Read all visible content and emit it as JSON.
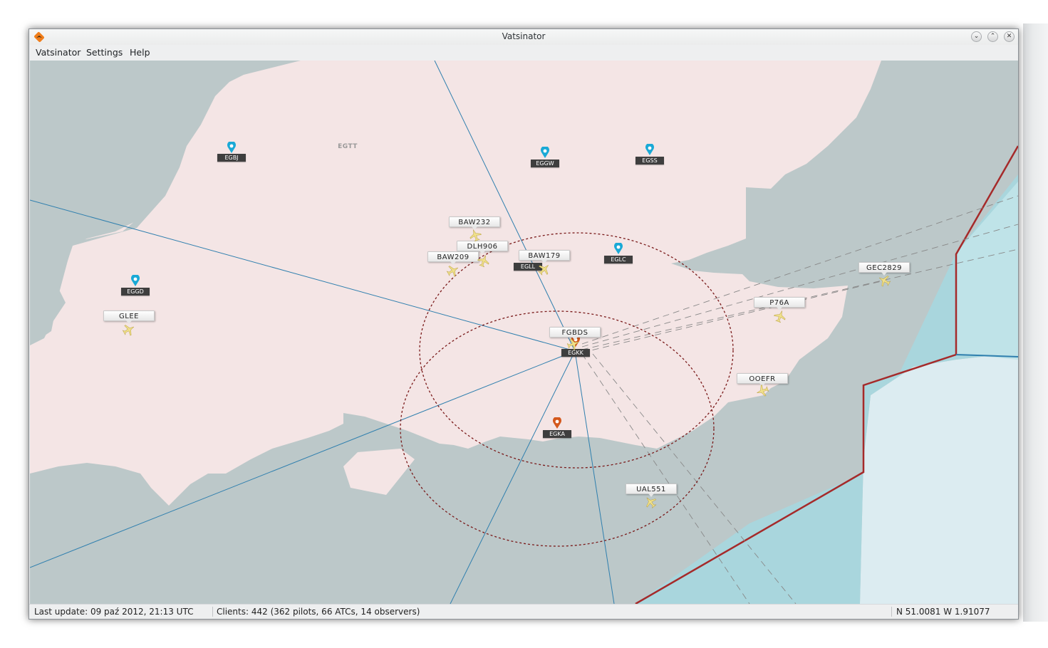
{
  "window": {
    "title": "Vatsinator",
    "buttons": [
      "minimize",
      "maximize",
      "close"
    ]
  },
  "menu": {
    "items": [
      "Vatsinator",
      "Settings",
      "Help"
    ]
  },
  "map": {
    "fir": "EGTT",
    "airports": [
      {
        "code": "EGBJ",
        "icon": "airport-marker-blue"
      },
      {
        "code": "EGGW",
        "icon": "airport-marker-blue"
      },
      {
        "code": "EGSS",
        "icon": "airport-marker-blue"
      },
      {
        "code": "EGLC",
        "icon": "airport-marker-blue"
      },
      {
        "code": "EGGD",
        "icon": "airport-marker-blue"
      },
      {
        "code": "EGLL",
        "icon": "airport-marker-none"
      },
      {
        "code": "EGKK",
        "icon": "airport-marker-orange"
      },
      {
        "code": "EGKA",
        "icon": "airport-marker-orange"
      }
    ],
    "flights": [
      "BAW232",
      "DLH906",
      "BAW209",
      "BAW179",
      "GLEE",
      "FGBDS",
      "P76A",
      "GEC2829",
      "OOEFR",
      "UAL551"
    ]
  },
  "status": {
    "last_update": "Last update: 09 paź 2012, 21:13 UTC",
    "clients": "Clients: 442 (362 pilots, 66 ATCs, 14 observers)",
    "coords": "N 51.0081 W 1.91077"
  },
  "colors": {
    "land_fir": "#f4e5e5",
    "land_outside": "#bcc8c9",
    "sea": "#a9d6dd",
    "sea_light": "#dcecf1",
    "border": "#a52a2a",
    "route_line": "#2f7fae",
    "range_circle": "#7a1a1a",
    "airport_blue": "#19a9d6",
    "airport_orange": "#d4581c"
  }
}
